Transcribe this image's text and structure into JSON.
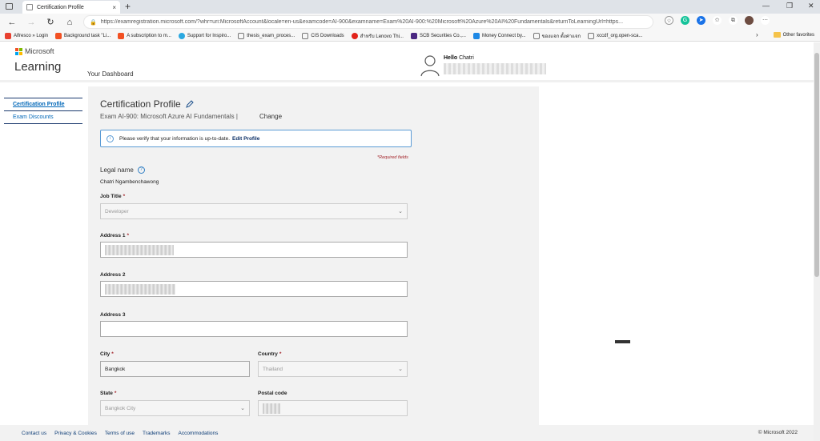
{
  "browser": {
    "tab_title": "Certification Profile",
    "tab_close": "×",
    "new_tab": "+",
    "url": "https://examregistration.microsoft.com/?whr=uri:MicrosoftAccount&locale=en-us&examcode=AI-900&examname=Exam%20AI-900:%20Microsoft%20Azure%20AI%20Fundamentals&returnToLearningUrl=https..."
  },
  "bookmarks": [
    {
      "label": "Alfresco » Login",
      "color": "#e8402f"
    },
    {
      "label": "Background task \"Li...",
      "color": "#f25022"
    },
    {
      "label": "A subscription to m...",
      "color": "#f25022"
    },
    {
      "label": "Support for Inspiro...",
      "color": "#2aa8e0"
    },
    {
      "label": "thesis_exam_proces...",
      "color": "#777777"
    },
    {
      "label": "CIS Downloads",
      "color": "#777777"
    },
    {
      "label": "สำหรับ Lenovo Thi...",
      "color": "#e2231a"
    },
    {
      "label": "SCB Securities Co.,...",
      "color": "#4b2882"
    },
    {
      "label": "Money Connect by...",
      "color": "#1e88e5"
    },
    {
      "label": "ของแจก ตั้งค่าแจก",
      "color": "#777777"
    },
    {
      "label": "xccdf_org.open-sca...",
      "color": "#777777"
    }
  ],
  "bookmarks_other": "Other favorites",
  "header": {
    "brand": "Microsoft",
    "product": "Learning",
    "dashboard": "Your Dashboard",
    "hello_bold": "Hello",
    "hello_name": "Chatri"
  },
  "sidenav": {
    "items": [
      "Certification Profile",
      "Exam Discounts"
    ]
  },
  "profile": {
    "title": "Certification Profile",
    "exam": "Exam AI-900: Microsoft Azure AI Fundamentals  |",
    "change": "Change",
    "notice": "Please verify that your information is up-to-date.",
    "edit_profile": "Edit Profile",
    "required_note": "*Required fields",
    "legal_name_label": "Legal name",
    "legal_name_value": "Chatri Ngambenchawong",
    "job_title_label": "Job Title",
    "job_title_value": "Developer",
    "address1_label": "Address 1",
    "address2_label": "Address 2",
    "address3_label": "Address 3",
    "city_label": "City",
    "city_value": "Bangkok",
    "country_label": "Country",
    "country_value": "Thailand",
    "state_label": "State",
    "state_value": "Bangkok City",
    "postal_label": "Postal code",
    "required_mark": "*"
  },
  "footer": {
    "links": [
      "Contact us",
      "Privacy & Cookies",
      "Terms of use",
      "Trademarks",
      "Accommodations"
    ],
    "copyright": "© Microsoft 2022"
  }
}
